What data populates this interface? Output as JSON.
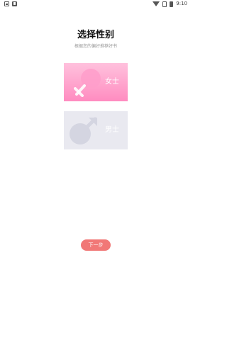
{
  "status_bar": {
    "time": "9:10",
    "left_icons": [
      "image-icon",
      "download-icon"
    ],
    "right_icons": [
      "wifi-icon",
      "sim-icon",
      "battery-icon"
    ]
  },
  "header": {
    "title": "选择性别",
    "subtitle": "根据您的偏好推荐好书"
  },
  "options": {
    "female": {
      "label": "女士",
      "icon": "female-symbol-icon",
      "colors": [
        "#ffc1dd",
        "#ff8cc0"
      ]
    },
    "male": {
      "label": "男士",
      "icon": "male-symbol-icon",
      "color": "#e9e9f0"
    }
  },
  "next_button": {
    "label": "下一步",
    "color": "#f17877"
  }
}
